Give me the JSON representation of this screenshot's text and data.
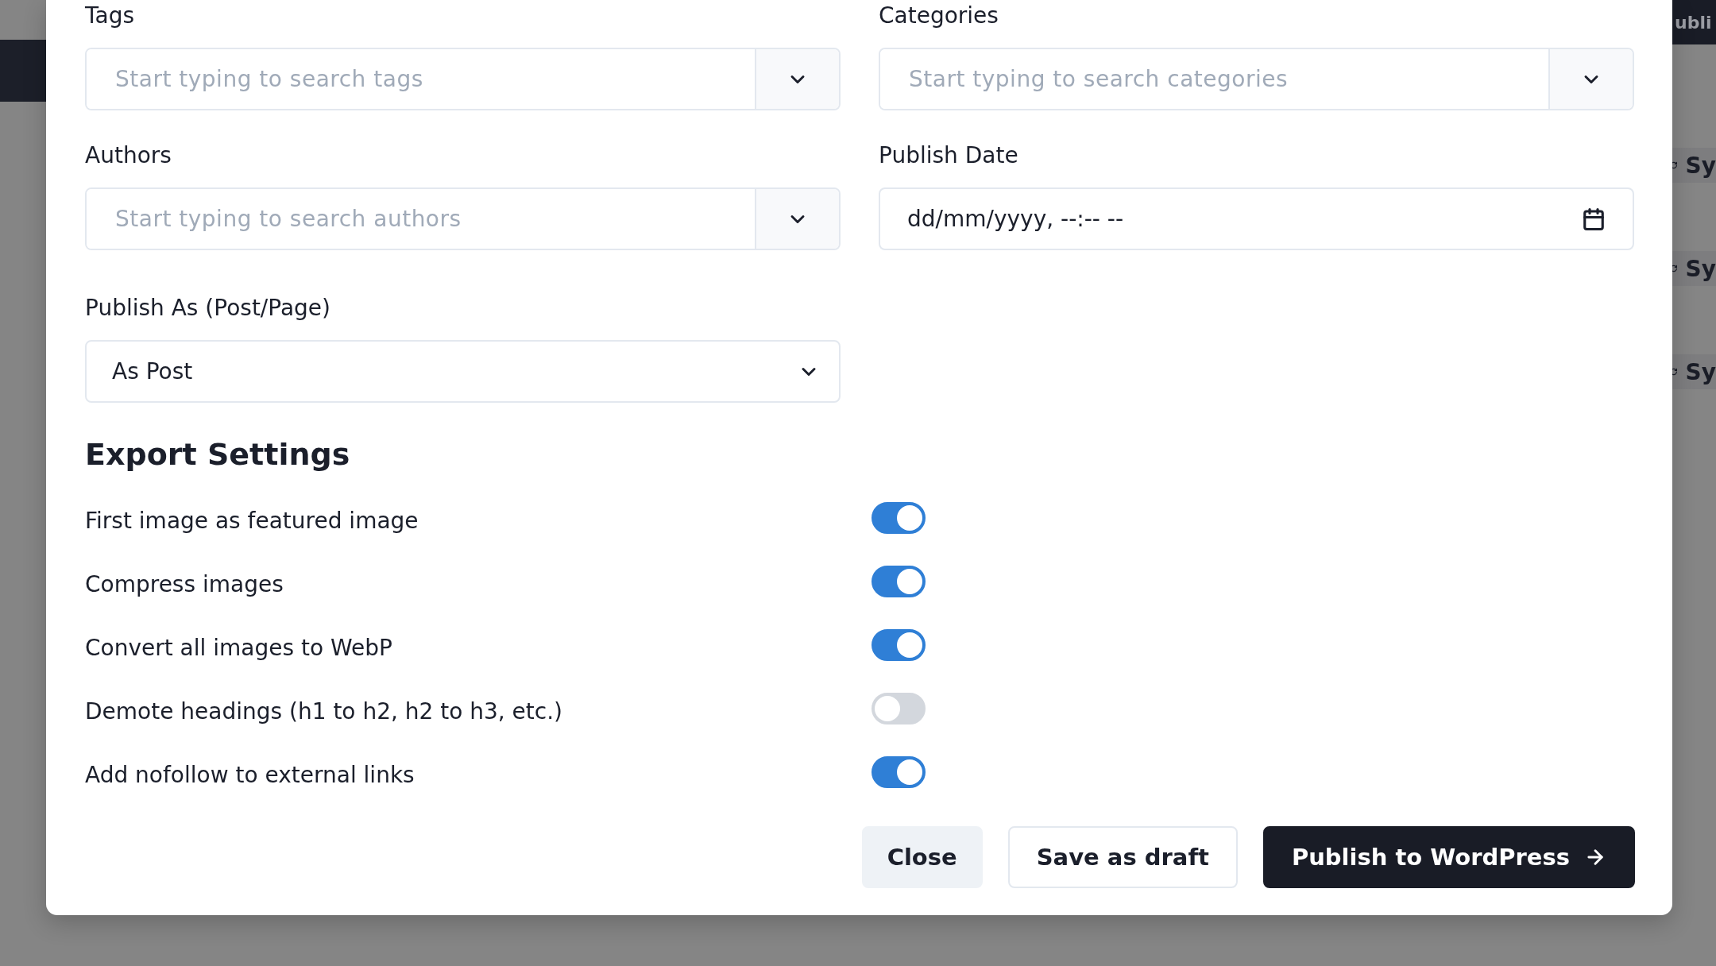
{
  "background": {
    "header_button": "ubli",
    "rows": [
      {
        "label": "Sy"
      },
      {
        "label": "Sy"
      },
      {
        "label": "Sy"
      }
    ]
  },
  "modal": {
    "fields": [
      {
        "kind": "combo",
        "label": "Tags",
        "placeholder": "Start typing to search tags"
      },
      {
        "kind": "combo",
        "label": "Categories",
        "placeholder": "Start typing to search categories"
      },
      {
        "kind": "combo",
        "label": "Authors",
        "placeholder": "Start typing to search authors"
      },
      {
        "kind": "datetime",
        "label": "Publish Date",
        "value": "dd/mm/yyyy, --:-- --"
      },
      {
        "kind": "select",
        "label": "Publish As (Post/Page)",
        "value": "As Post"
      }
    ],
    "export_settings": {
      "title": "Export Settings",
      "options": [
        {
          "label": "First image as featured image",
          "on": true
        },
        {
          "label": "Compress images",
          "on": true
        },
        {
          "label": "Convert all images to WebP",
          "on": true
        },
        {
          "label": "Demote headings (h1 to h2, h2 to h3, etc.)",
          "on": false
        },
        {
          "label": "Add nofollow to external links",
          "on": true
        }
      ]
    },
    "buttons": [
      {
        "label": "Close",
        "kind": "secondary"
      },
      {
        "label": "Save as draft",
        "kind": "outline"
      },
      {
        "label": "Publish to WordPress",
        "kind": "primary"
      }
    ]
  }
}
